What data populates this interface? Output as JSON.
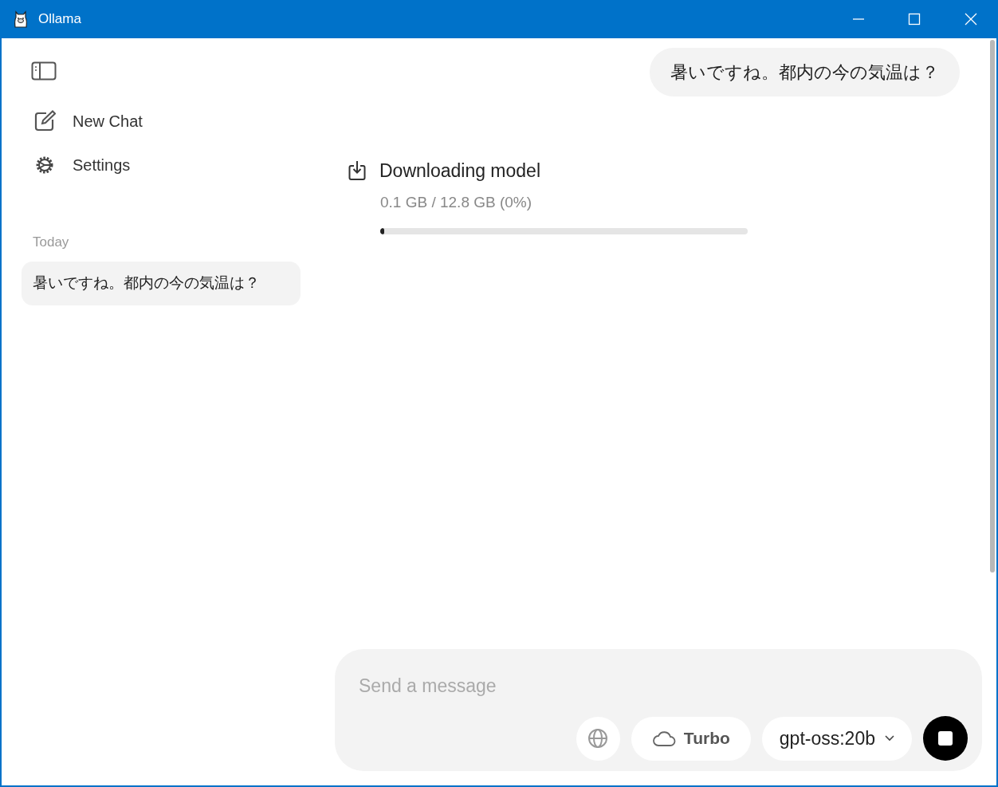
{
  "window": {
    "title": "Ollama"
  },
  "sidebar": {
    "items": [
      {
        "label": "New Chat",
        "kind": "new-chat"
      },
      {
        "label": "Settings",
        "kind": "settings"
      }
    ],
    "history": {
      "heading": "Today",
      "chats": [
        {
          "title": "暑いですね。都内の今の気温は？",
          "selected": true
        }
      ]
    }
  },
  "messages": [
    {
      "kind": "user",
      "text": "暑いですね。都内の今の気温は？"
    }
  ],
  "download": {
    "title": "Downloading model",
    "progress": "0.1 GB / 12.8 GB (0%)",
    "level": 0.01
  },
  "composer": {
    "placeholder": "Send a message",
    "turbo": "Turbo",
    "model": "gpt-oss:20b"
  }
}
